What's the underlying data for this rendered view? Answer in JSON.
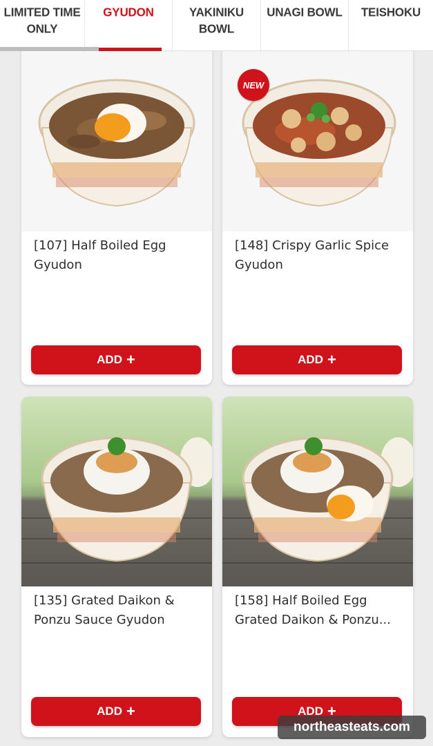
{
  "tabs": [
    {
      "label": "LIMITED TIME\nONLY",
      "active": false
    },
    {
      "label": "GYUDON",
      "active": true
    },
    {
      "label": "YAKINIKU\nBOWL",
      "active": false
    },
    {
      "label": "UNAGI BOWL",
      "active": false
    },
    {
      "label": "TEISHOKU",
      "active": false
    }
  ],
  "products": [
    {
      "title": "[107] Half Boiled Egg Gyudon",
      "button": "ADD",
      "badge": "",
      "image": "bowl-egg-icon"
    },
    {
      "title": "[148] Crispy Garlic Spice Gyudon",
      "button": "ADD",
      "badge": "NEW",
      "image": "bowl-garlic-icon"
    },
    {
      "title": "[135] Grated Daikon & Ponzu Sauce Gyudon",
      "button": "ADD",
      "badge": "",
      "image": "bowl-daikon-icon"
    },
    {
      "title": "[158] Half Boiled Egg Grated Daikon & Ponzu...",
      "button": "ADD",
      "badge": "",
      "image": "bowl-daikon-egg-icon"
    }
  ],
  "watermark": "northeasteats.com",
  "colors": {
    "accent": "#d0121b",
    "background": "#ececec"
  }
}
